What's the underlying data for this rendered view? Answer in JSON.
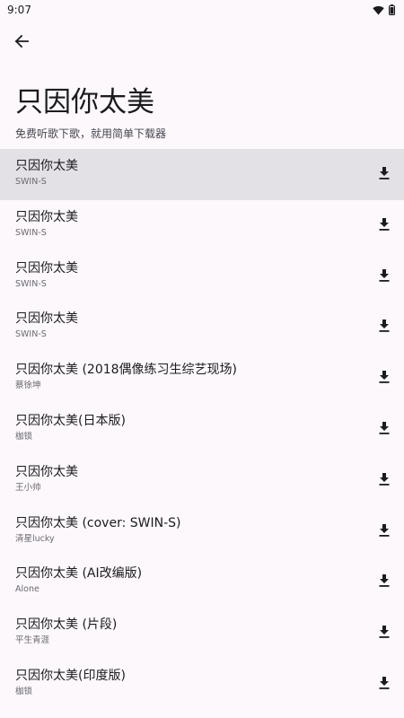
{
  "status_bar": {
    "time": "9:07",
    "icons": [
      "wifi-icon",
      "battery-icon"
    ]
  },
  "top_bar": {
    "back_icon": "arrow-back-icon"
  },
  "header": {
    "title": "只因你太美",
    "subtitle": "免费听歌下歌，就用简单下载器"
  },
  "songs": [
    {
      "title": "只因你太美",
      "artist": "SWIN-S",
      "selected": true
    },
    {
      "title": "只因你太美",
      "artist": "SWIN-S",
      "selected": false
    },
    {
      "title": "只因你太美",
      "artist": "SWIN-S",
      "selected": false
    },
    {
      "title": "只因你太美",
      "artist": "SWIN-S",
      "selected": false
    },
    {
      "title": "只因你太美 (2018偶像练习生综艺现场)",
      "artist": "蔡徐坤",
      "selected": false
    },
    {
      "title": "只因你太美(日本版)",
      "artist": "枷锁",
      "selected": false
    },
    {
      "title": "只因你太美",
      "artist": "王小帅",
      "selected": false
    },
    {
      "title": "只因你太美 (cover: SWIN-S)",
      "artist": "清星lucky",
      "selected": false
    },
    {
      "title": "只因你太美 (AI改编版)",
      "artist": "Alone",
      "selected": false
    },
    {
      "title": "只因你太美 (片段)",
      "artist": "平生青涯",
      "selected": false
    },
    {
      "title": "只因你太美(印度版)",
      "artist": "枷锁",
      "selected": false
    }
  ],
  "download_icon": "download-icon",
  "colors": {
    "background": "#fcf8fc",
    "selected_row": "#e4e1e6",
    "text_primary": "#1c1b1f",
    "text_secondary": "#6b6870"
  }
}
